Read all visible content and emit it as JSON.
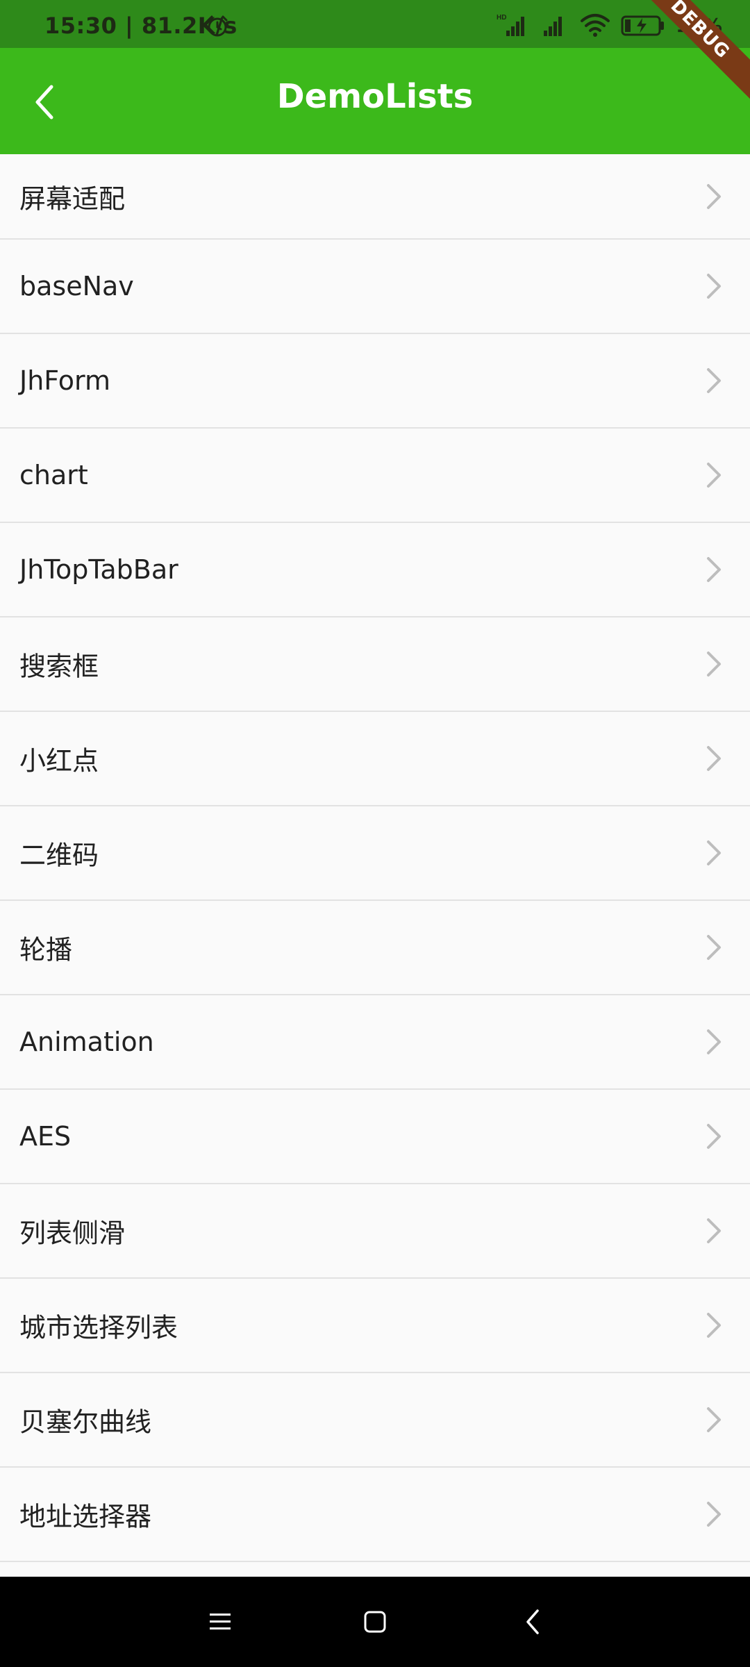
{
  "status_bar": {
    "time_speed": "15:30 | 81.2K/s",
    "battery_percent": "18%",
    "alarm_icon": "alarm-clock-icon",
    "signal_icons": [
      "hd-signal-icon",
      "signal-icon"
    ],
    "wifi_icon": "wifi-icon",
    "battery_icon": "battery-charging-icon"
  },
  "app_bar": {
    "title": "DemoLists",
    "back_icon": "chevron-left-icon",
    "background": "#3cb91b"
  },
  "debug_banner": {
    "label": "DEBUG",
    "color": "#7a3a16"
  },
  "list": {
    "items": [
      {
        "label": "屏幕适配"
      },
      {
        "label": "baseNav"
      },
      {
        "label": "JhForm"
      },
      {
        "label": "chart"
      },
      {
        "label": "JhTopTabBar"
      },
      {
        "label": "搜索框"
      },
      {
        "label": "小红点"
      },
      {
        "label": "二维码"
      },
      {
        "label": "轮播"
      },
      {
        "label": "Animation"
      },
      {
        "label": "AES"
      },
      {
        "label": "列表侧滑"
      },
      {
        "label": "城市选择列表"
      },
      {
        "label": "贝塞尔曲线"
      },
      {
        "label": "地址选择器"
      }
    ]
  },
  "nav_bar": {
    "menu_icon": "menu-icon",
    "home_icon": "home-square-icon",
    "back_icon": "back-triangle-icon"
  }
}
